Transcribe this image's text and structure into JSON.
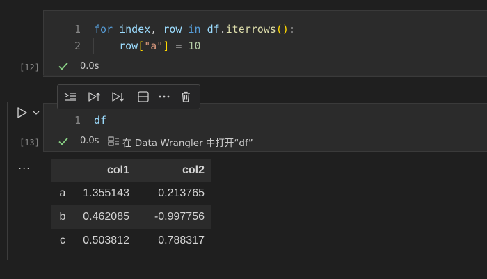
{
  "cells": [
    {
      "exec_count": "[12]",
      "status_time": "0.0s",
      "lines": [
        {
          "no": "1"
        },
        {
          "no": "2"
        }
      ],
      "tokens": {
        "l1_kw_for": "for",
        "l1_index": "index",
        "l1_comma": ",",
        "l1_row": "row",
        "l1_kw_in": "in",
        "l1_df": "df",
        "l1_dot": ".",
        "l1_fn": "iterrows",
        "l1_paren": "()",
        "l1_colon": ":",
        "l2_row": "row",
        "l2_lb": "[",
        "l2_str": "\"a\"",
        "l2_rb": "]",
        "l2_eq": "=",
        "l2_num": "10"
      }
    },
    {
      "exec_count": "[13]",
      "status_time": "0.0s",
      "line_no": "1",
      "code": "df",
      "wrangler_label": "在 Data Wrangler 中打开“df”"
    }
  ],
  "output": {
    "more_label": "...",
    "table": {
      "columns": [
        "",
        "col1",
        "col2"
      ],
      "rows": [
        {
          "index": "a",
          "col1": "1.355143",
          "col2": "0.213765"
        },
        {
          "index": "b",
          "col1": "0.462085",
          "col2": "-0.997756"
        },
        {
          "index": "c",
          "col1": "0.503812",
          "col2": "0.788317"
        }
      ]
    }
  },
  "toolbar": {
    "icons": [
      "run-by-line-icon",
      "execute-above-icon",
      "execute-below-icon",
      "split-cell-icon",
      "more-actions-icon",
      "delete-icon"
    ]
  },
  "colors": {
    "background": "#1f1f1f",
    "cell_background": "#2b2b2b",
    "success": "#89d185",
    "keyword": "#569cd6"
  }
}
